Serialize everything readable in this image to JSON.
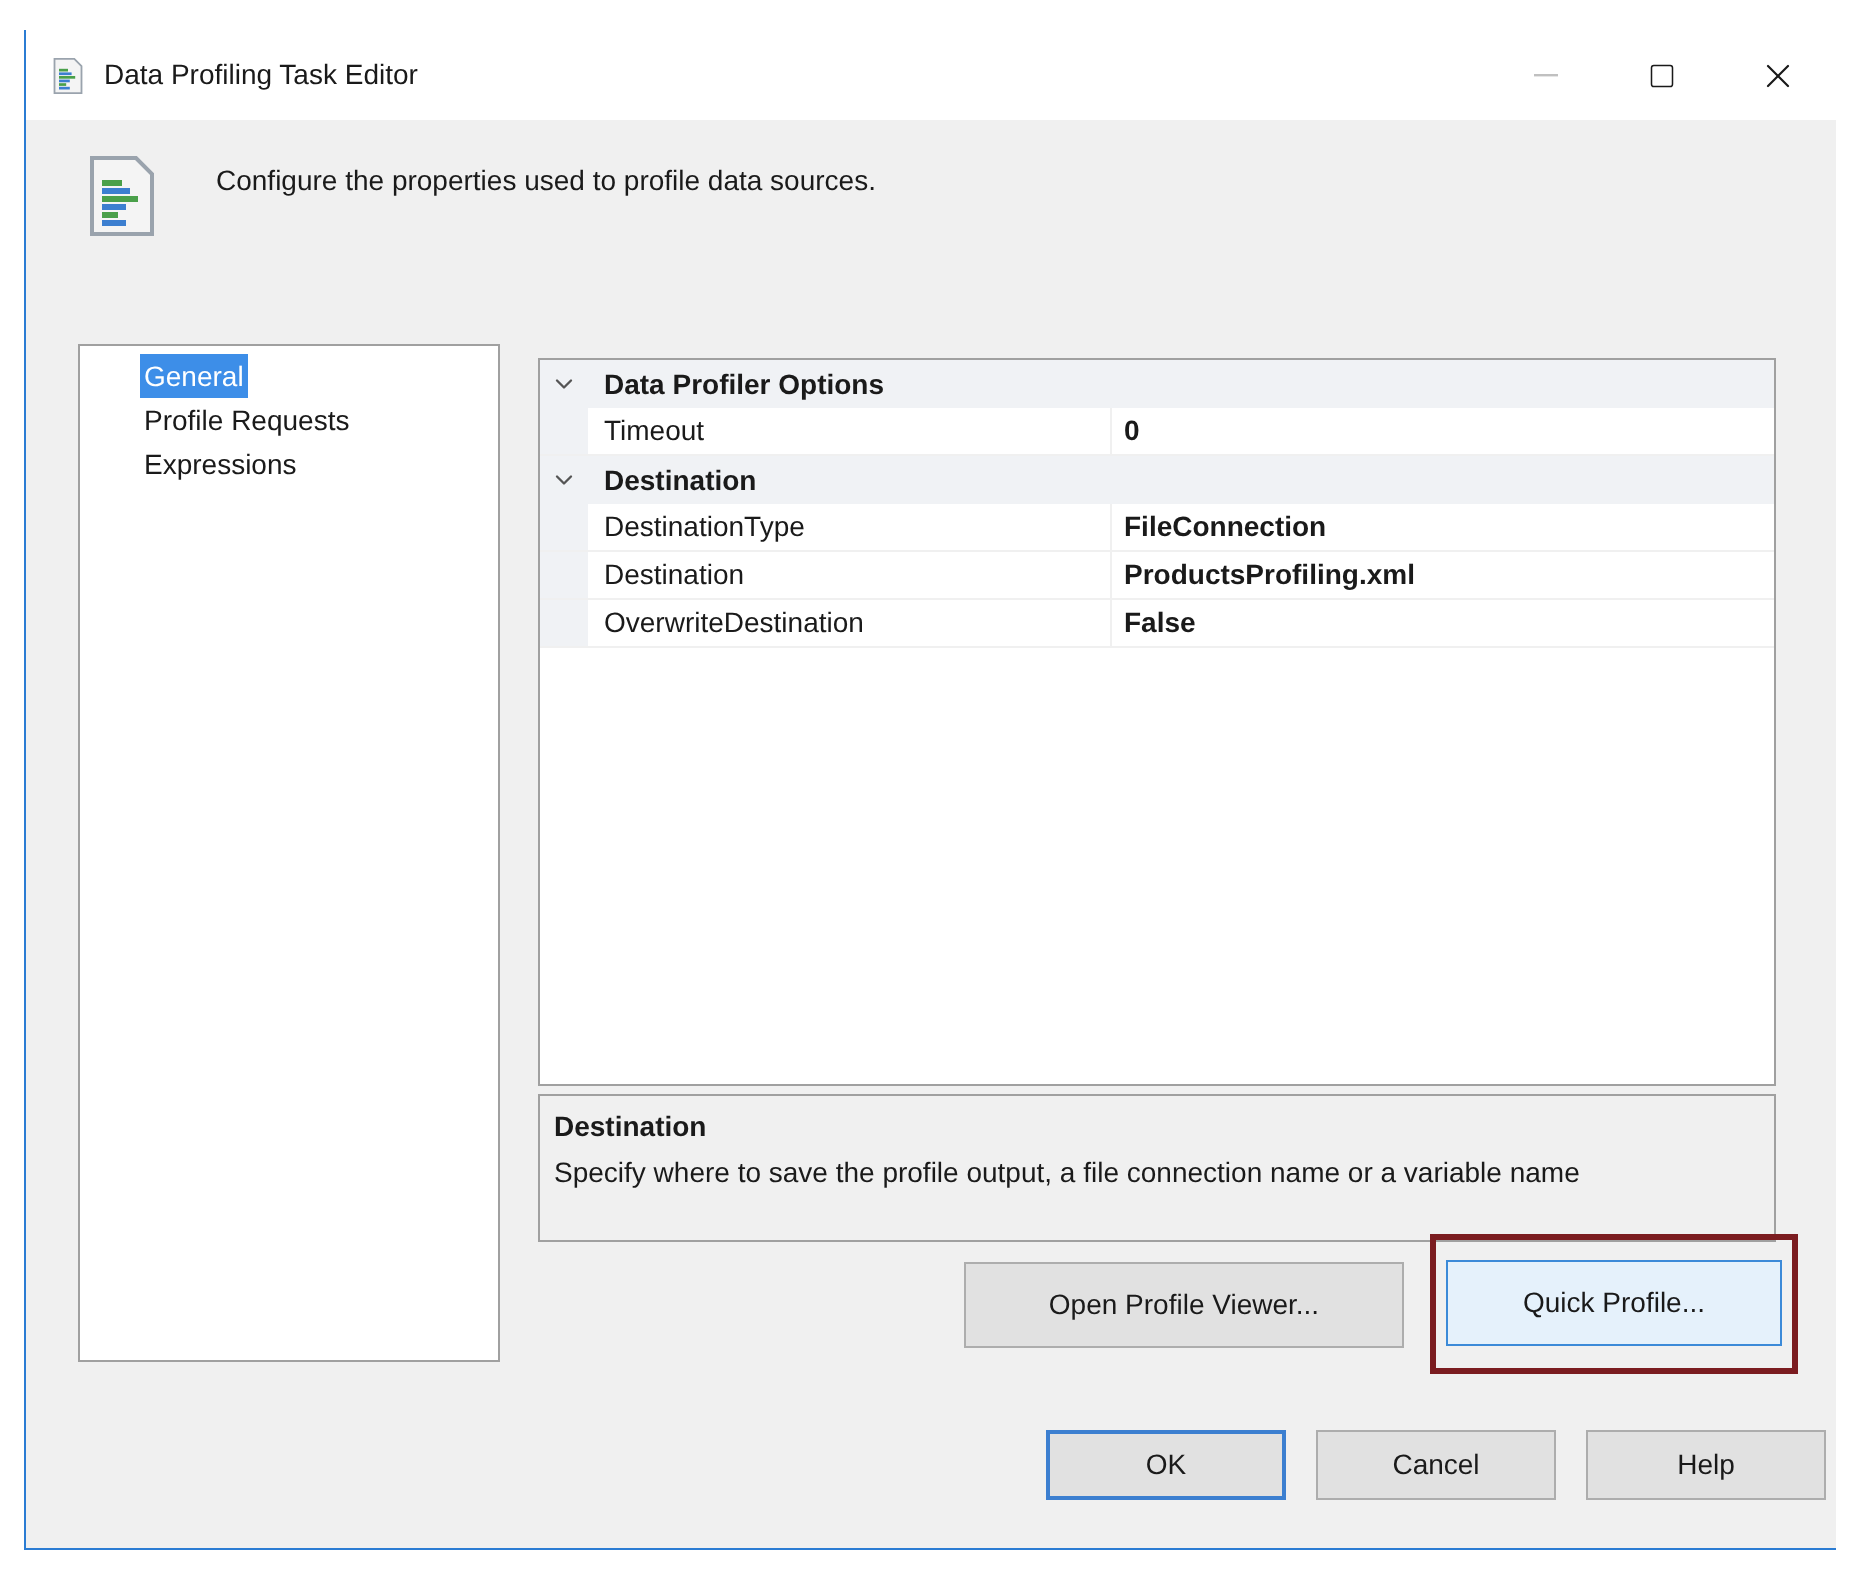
{
  "window": {
    "title": "Data Profiling Task Editor",
    "minimize_disabled": true
  },
  "header": {
    "text": "Configure the properties used to profile data sources."
  },
  "sidebar": {
    "items": [
      {
        "label": "General",
        "selected": true
      },
      {
        "label": "Profile Requests",
        "selected": false
      },
      {
        "label": "Expressions",
        "selected": false
      }
    ]
  },
  "property_grid": {
    "categories": [
      {
        "name": "Data Profiler Options",
        "expanded": true,
        "properties": [
          {
            "name": "Timeout",
            "value": "0"
          }
        ]
      },
      {
        "name": "Destination",
        "expanded": true,
        "properties": [
          {
            "name": "DestinationType",
            "value": "FileConnection"
          },
          {
            "name": "Destination",
            "value": "ProductsProfiling.xml"
          },
          {
            "name": "OverwriteDestination",
            "value": "False"
          }
        ]
      }
    ]
  },
  "description": {
    "title": "Destination",
    "text": "Specify where to save the profile output, a file connection name or a variable name"
  },
  "action_buttons": [
    {
      "label": "Open Profile Viewer...",
      "highlighted": false,
      "focused": false
    },
    {
      "label": "Quick Profile...",
      "highlighted": true,
      "focused": true
    }
  ],
  "dialog_buttons": [
    {
      "label": "OK",
      "default": true
    },
    {
      "label": "Cancel",
      "default": false
    },
    {
      "label": "Help",
      "default": false
    }
  ]
}
